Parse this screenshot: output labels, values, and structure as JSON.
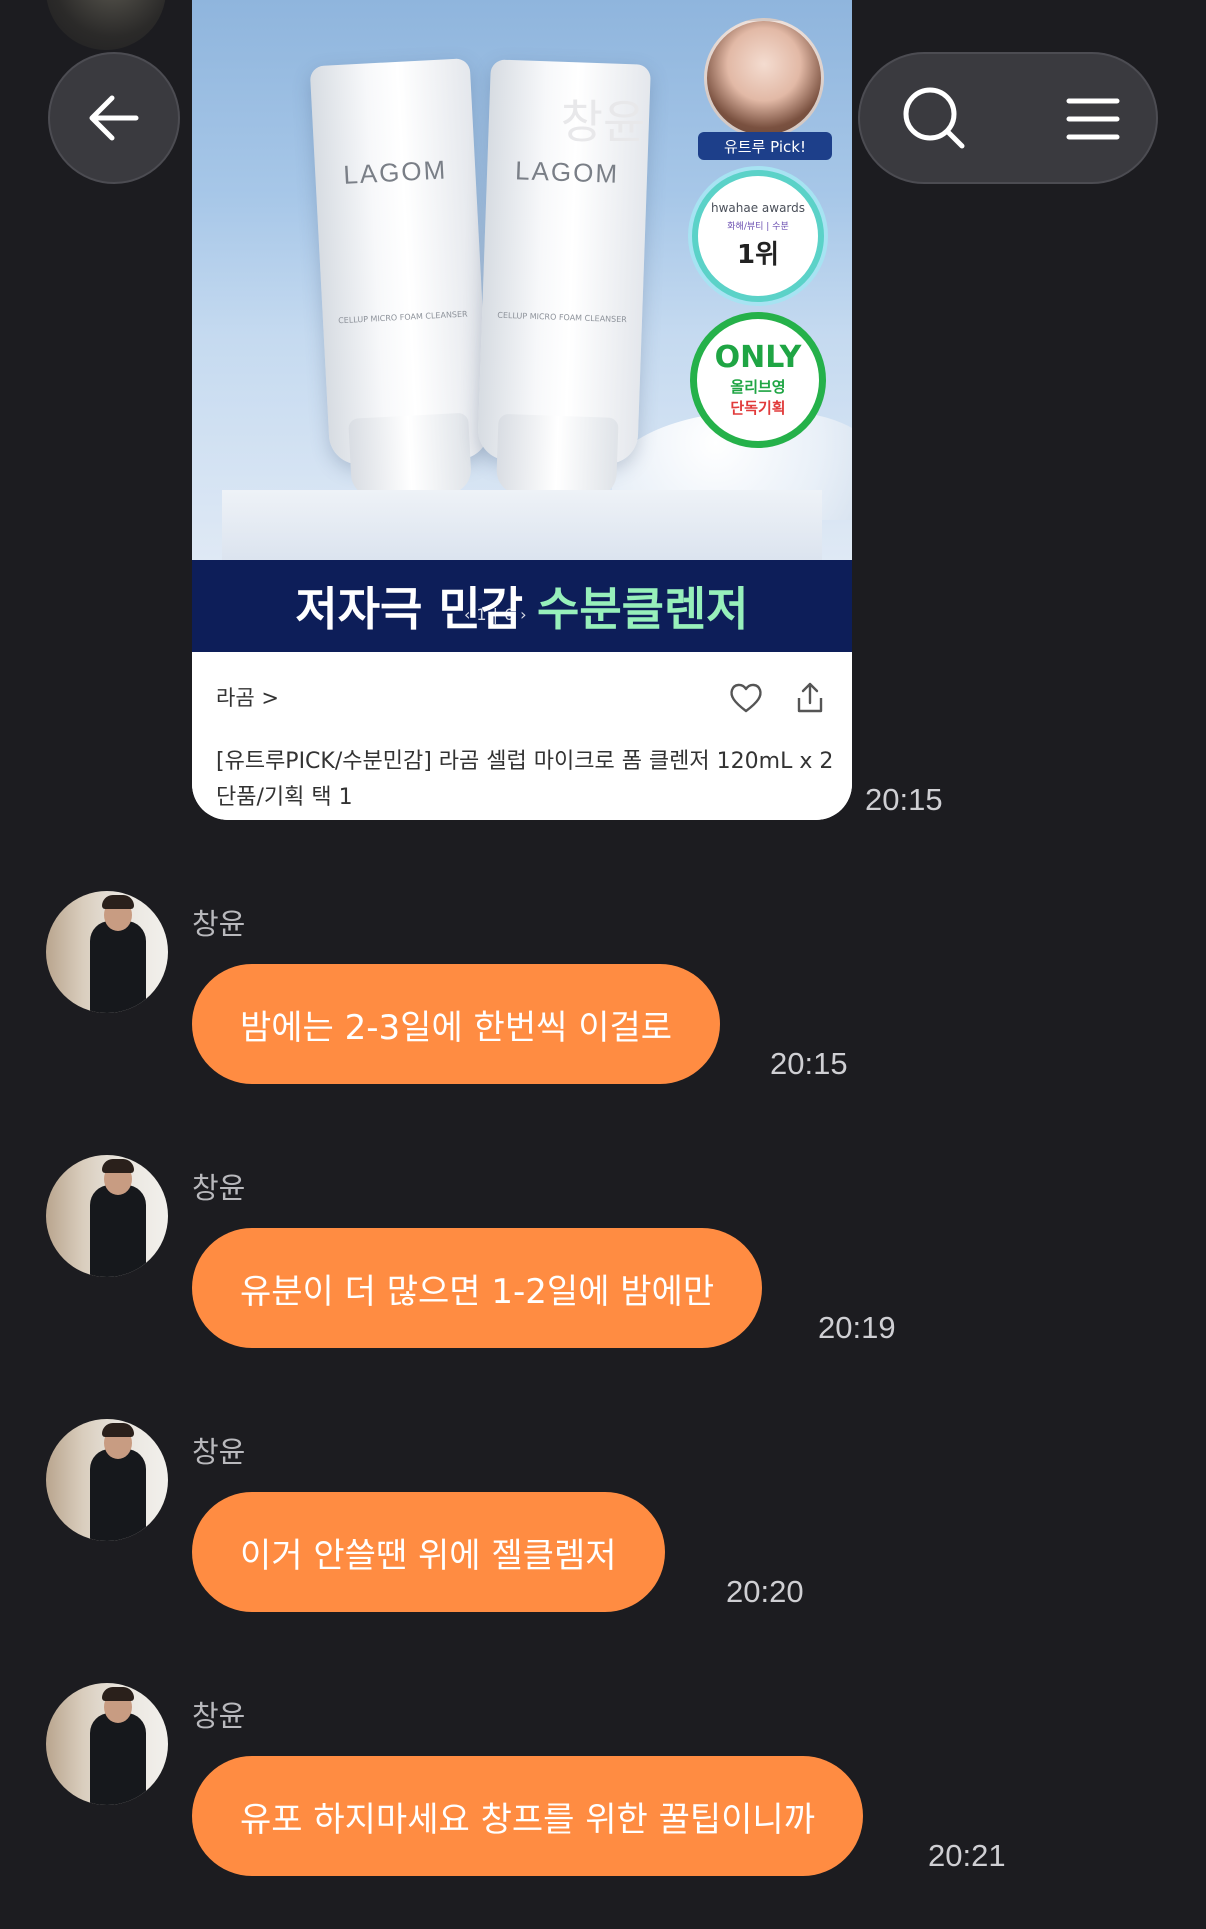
{
  "header": {
    "title": "창윤",
    "back_icon": "arrow-left-icon",
    "search_icon": "search-icon",
    "menu_icon": "hamburger-menu-icon"
  },
  "product_card": {
    "image_tube_brand": "LAGOM",
    "image_tube_subtitle": "CELLUP MICRO FOAM CLEANSER",
    "face_badge_label": "유트루 Pick!",
    "award_badge": {
      "line1": "hwahae awards",
      "line2": "화해/뷰티 | 수분",
      "rank": "1위"
    },
    "only_badge": {
      "line1": "ONLY",
      "line2": "올리브영",
      "line3": "단독기획"
    },
    "banner_white": "저자극 민감",
    "banner_green": "수분클렌저",
    "pager": {
      "current": "1",
      "separator": "|",
      "total": "6"
    },
    "brand_link": "라곰 >",
    "title": "[유트루PICK/수분민감] 라곰 셀럽 마이크로 폼 클렌저 120mL x 2 단품/기획 택 1",
    "time": "20:15"
  },
  "messages": [
    {
      "sender": "창윤",
      "text": "밤에는 2-3일에 한번씩 이걸로",
      "time": "20:15"
    },
    {
      "sender": "창윤",
      "text": "유분이 더 많으면 1-2일에 밤에만",
      "time": "20:19"
    },
    {
      "sender": "창윤",
      "text": "이거 안쓸땐 위에 젤클렘저",
      "time": "20:20"
    },
    {
      "sender": "창윤",
      "text": "유포 하지마세요 창프를 위한 꿀팁이니까",
      "time": "20:21"
    }
  ],
  "colors": {
    "background": "#1c1c20",
    "bubble": "#ff8c42",
    "banner": "#0d1e59",
    "banner_accent": "#97f0bb"
  }
}
